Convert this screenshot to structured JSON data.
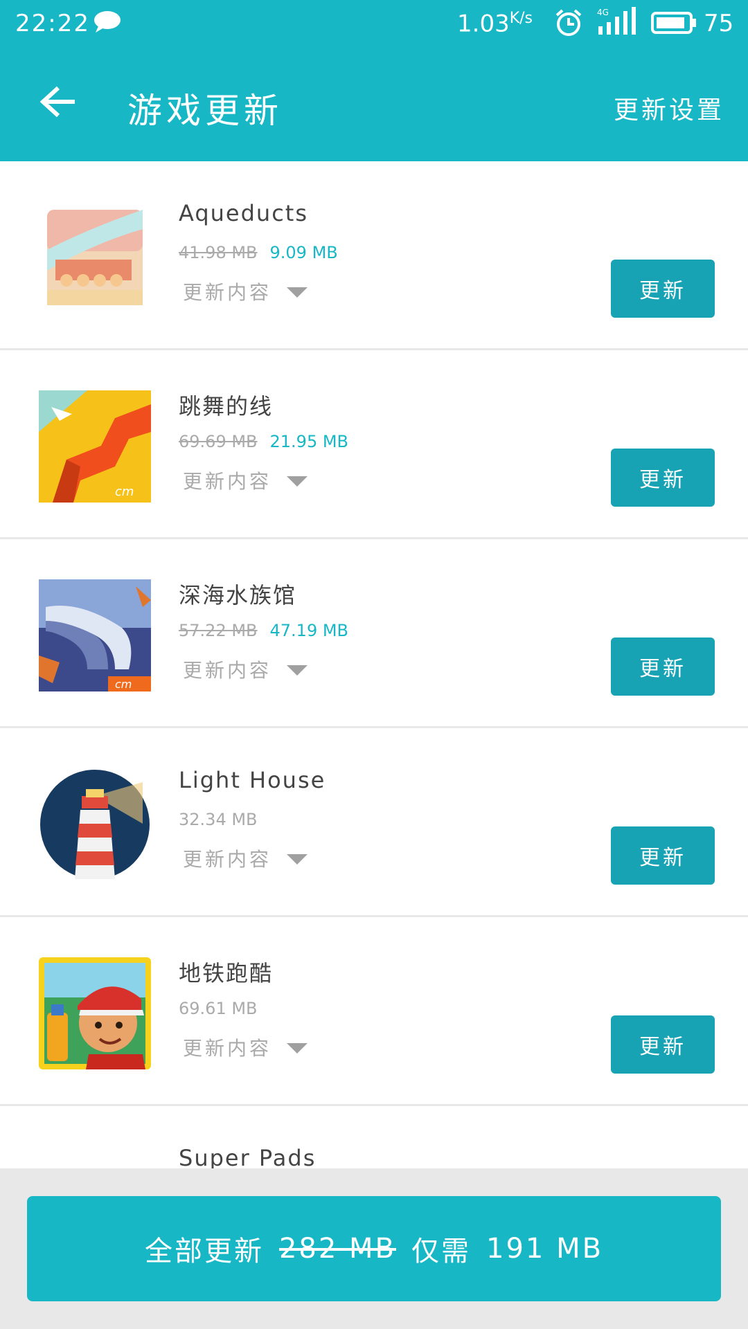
{
  "status_bar": {
    "time": "22:22",
    "net_speed": "1.03",
    "net_unit": "K/s",
    "battery": "75",
    "icons": [
      "chat-icon",
      "alarm-icon",
      "signal-4g-icon",
      "battery-icon"
    ]
  },
  "app_bar": {
    "title": "游戏更新",
    "settings_label": "更新设置"
  },
  "colors": {
    "accent": "#17b7c6",
    "button": "#17a3b3",
    "muted_text": "#aaaaaa",
    "divider": "#e8e8e8"
  },
  "apps": [
    {
      "name": "Aqueducts",
      "old_size": "41.98 MB",
      "new_size": "9.09 MB",
      "changelog_label": "更新内容",
      "update_label": "更新"
    },
    {
      "name": "跳舞的线",
      "old_size": "69.69 MB",
      "new_size": "21.95 MB",
      "changelog_label": "更新内容",
      "update_label": "更新"
    },
    {
      "name": "深海水族馆",
      "old_size": "57.22 MB",
      "new_size": "47.19 MB",
      "changelog_label": "更新内容",
      "update_label": "更新"
    },
    {
      "name": "Light House",
      "size": "32.34 MB",
      "changelog_label": "更新内容",
      "update_label": "更新"
    },
    {
      "name": "地铁跑酷",
      "size": "69.61 MB",
      "changelog_label": "更新内容",
      "update_label": "更新"
    },
    {
      "name": "Super Pads"
    }
  ],
  "bottom": {
    "update_all_label": "全部更新",
    "total_old": "282 MB",
    "need_label": "仅需",
    "total_new": "191 MB"
  }
}
